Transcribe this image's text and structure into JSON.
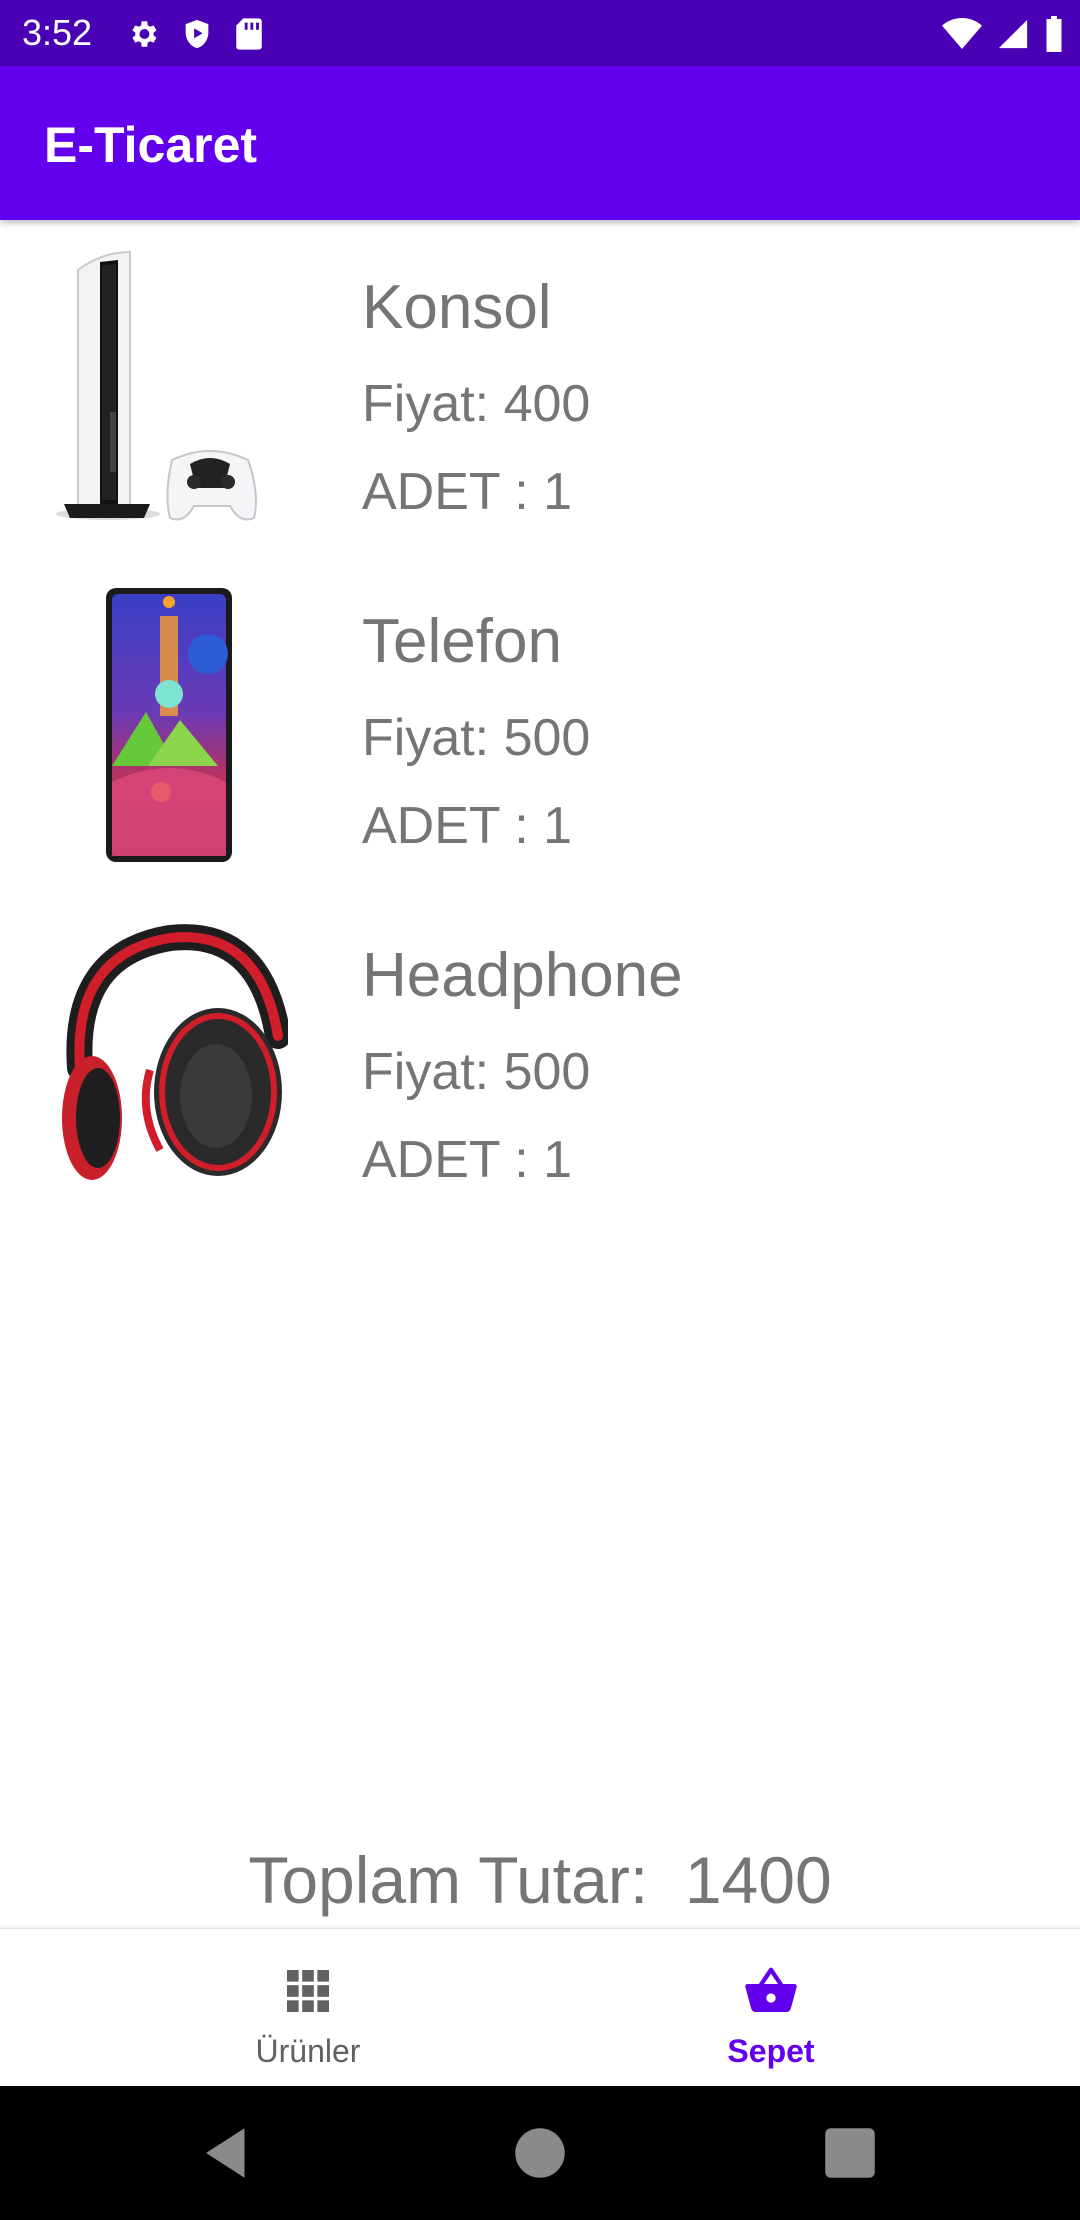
{
  "status_bar": {
    "time": "3:52",
    "left_icons": [
      "gear-icon",
      "shield-play-icon",
      "sd-card-icon"
    ],
    "right_icons": [
      "wifi-icon",
      "signal-icon",
      "battery-icon"
    ]
  },
  "app_bar": {
    "title": "E-Ticaret"
  },
  "cart_items": [
    {
      "name": "Konsol",
      "price": "Fiyat: 400",
      "quantity": "ADET : 1",
      "image": "game-console-image"
    },
    {
      "name": "Telefon",
      "price": "Fiyat: 500",
      "quantity": "ADET : 1",
      "image": "smartphone-image"
    },
    {
      "name": "Headphone",
      "price": "Fiyat: 500",
      "quantity": "ADET : 1",
      "image": "headphone-image"
    }
  ],
  "total": {
    "text": "Toplam Tutar:  1400"
  },
  "bottom_nav": {
    "products_label": "Ürünler",
    "cart_label": "Sepet",
    "active": "cart"
  },
  "colors": {
    "status_bar": "#4a00b4",
    "primary": "#6200ee",
    "text_secondary": "#757575"
  },
  "system_nav": [
    "back-icon",
    "home-icon",
    "recents-icon"
  ]
}
